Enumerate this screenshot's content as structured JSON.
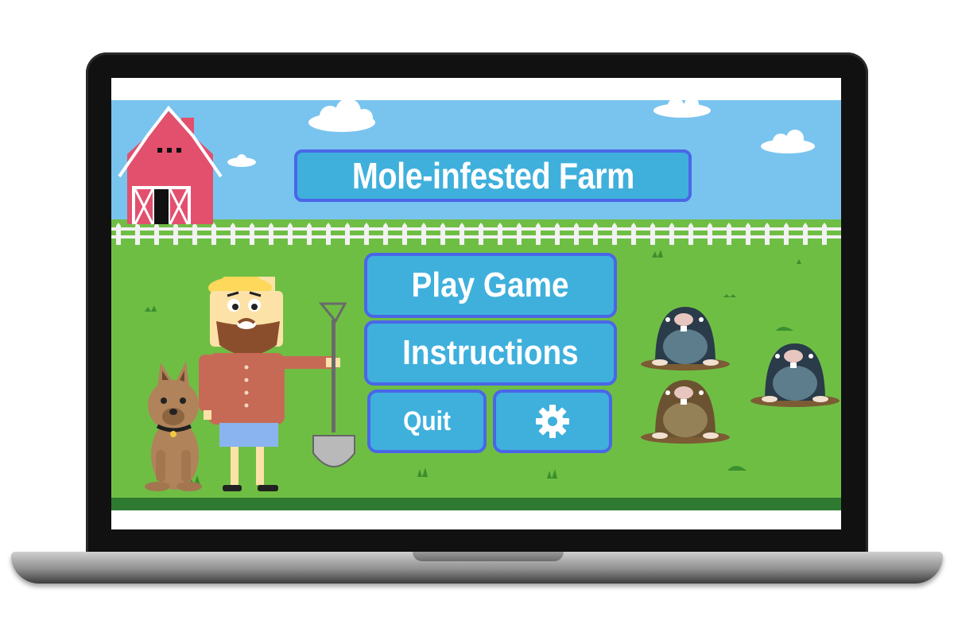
{
  "game": {
    "title": "Mole-infested Farm",
    "menu": {
      "play_label": "Play Game",
      "instructions_label": "Instructions",
      "quit_label": "Quit",
      "settings_icon": "gear-icon"
    }
  },
  "colors": {
    "sky": "#79c4ee",
    "grass": "#6fbe44",
    "button_fill": "#3fb0dc",
    "button_border": "#4a66e8",
    "barn": "#e2506e"
  }
}
